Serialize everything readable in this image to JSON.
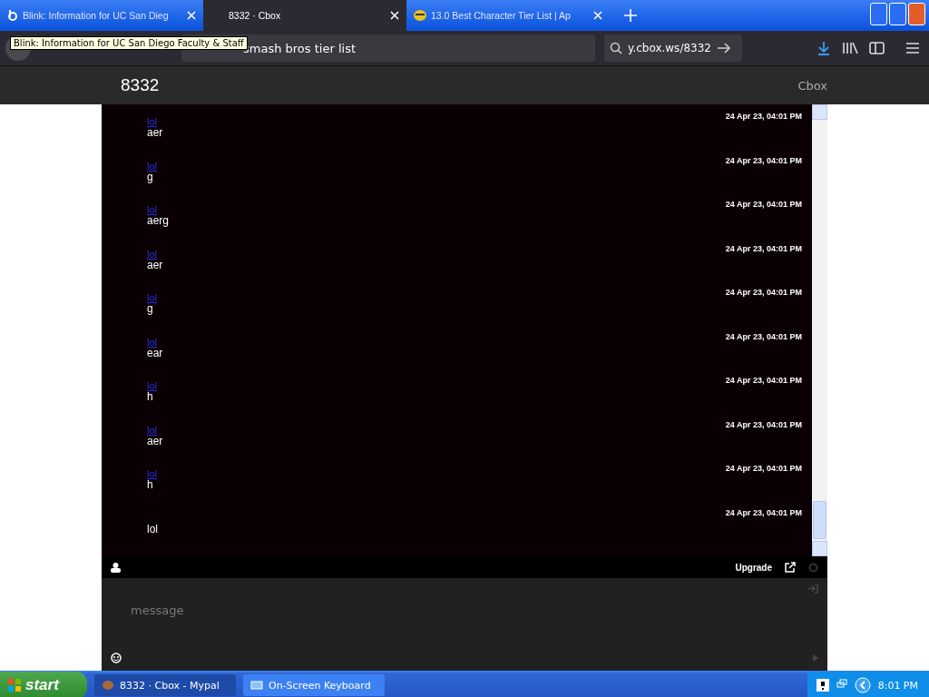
{
  "browser": {
    "tabs": [
      {
        "title": "Blink: Information for UC San Dieg",
        "selected": false
      },
      {
        "title": "8332 · Cbox",
        "selected": true
      },
      {
        "title": "13.0 Best Character Tier List | Ap",
        "selected": false
      }
    ],
    "tooltip": "Blink: Information for UC San Diego Faculty & Staff",
    "address": "smash bros tier list",
    "search": "y.cbox.ws/8332"
  },
  "page": {
    "title": "8332",
    "brand": "Cbox",
    "messages": [
      {
        "name": "lol",
        "text": "aer",
        "time": "24 Apr 23, 04:01 PM"
      },
      {
        "name": "lol",
        "text": "g",
        "time": "24 Apr 23, 04:01 PM"
      },
      {
        "name": "lol",
        "text": "aerg",
        "time": "24 Apr 23, 04:01 PM"
      },
      {
        "name": "lol",
        "text": "aer",
        "time": "24 Apr 23, 04:01 PM"
      },
      {
        "name": "lol",
        "text": "g",
        "time": "24 Apr 23, 04:01 PM"
      },
      {
        "name": "lol",
        "text": "ear",
        "time": "24 Apr 23, 04:01 PM"
      },
      {
        "name": "lol",
        "text": "h",
        "time": "24 Apr 23, 04:01 PM"
      },
      {
        "name": "lol",
        "text": "aer",
        "time": "24 Apr 23, 04:01 PM"
      },
      {
        "name": "lol",
        "text": "h",
        "time": "24 Apr 23, 04:01 PM"
      },
      {
        "text": "lol",
        "time": "24 Apr 23, 04:01 PM"
      }
    ],
    "upgrade": "Upgrade",
    "input": {
      "placeholder": "message"
    }
  },
  "taskbar": {
    "start": "start",
    "tasks": [
      {
        "label": "8332 · Cbox - Mypal",
        "selected": true
      },
      {
        "label": "On-Screen Keyboard",
        "selected": false
      }
    ],
    "clock": "8:01 PM"
  }
}
